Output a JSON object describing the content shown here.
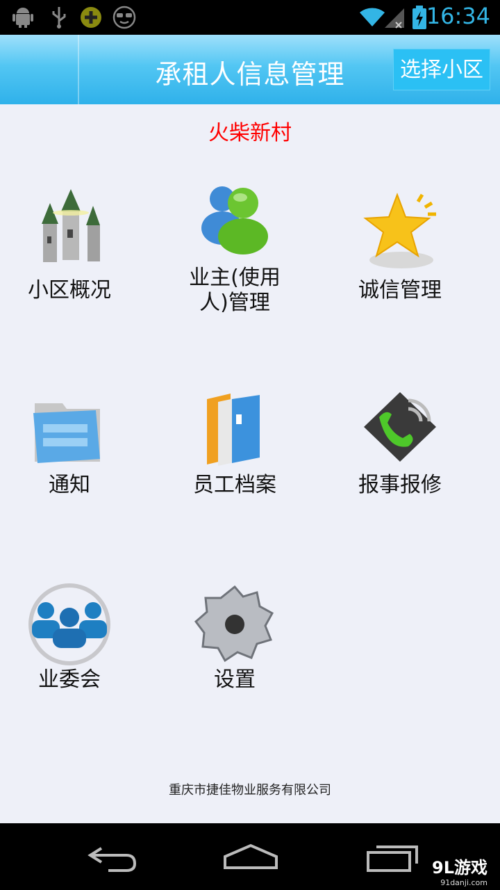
{
  "status_bar": {
    "time": "16:34",
    "icons": [
      "android-debug-icon",
      "usb-icon",
      "app-notification-icon",
      "sunglasses-icon",
      "wifi-icon",
      "signal-icon",
      "battery-charging-icon"
    ]
  },
  "header": {
    "title": "承租人信息管理",
    "select_button": "选择小区"
  },
  "community_name": "火柴新村",
  "menu": [
    {
      "label": "小区概况",
      "icon": "castle-icon"
    },
    {
      "label": "业主(使用人)管理",
      "label_line1": "业主(使用",
      "label_line2": "人)管理",
      "icon": "users-icon"
    },
    {
      "label": "诚信管理",
      "icon": "star-icon"
    },
    {
      "label": "通知",
      "icon": "folder-icon"
    },
    {
      "label": "员工档案",
      "icon": "files-icon"
    },
    {
      "label": "报事报修",
      "icon": "phone-icon"
    },
    {
      "label": "业委会",
      "icon": "committee-icon"
    },
    {
      "label": "设置",
      "icon": "gear-icon"
    }
  ],
  "footer": "重庆市捷佳物业服务有限公司",
  "nav": [
    "back-icon",
    "home-icon",
    "recent-apps-icon"
  ],
  "watermark": {
    "brand": "9L游戏",
    "site": "91danji.com"
  },
  "colors": {
    "accent": "#2bc0f4",
    "community": "#ff0000",
    "background": "#eef0f8"
  }
}
